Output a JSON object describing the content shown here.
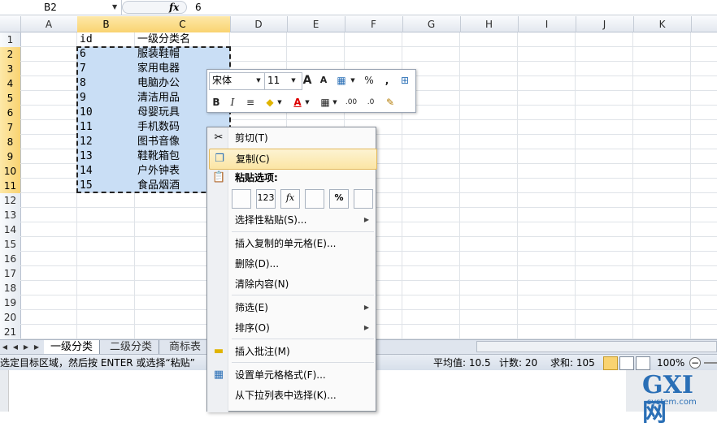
{
  "formula_bar": {
    "name_box": "B2",
    "fx_label": "fx",
    "value": "6"
  },
  "columns": [
    "A",
    "B",
    "C",
    "D",
    "E",
    "F",
    "G",
    "H",
    "I",
    "J",
    "K"
  ],
  "rows": [
    "1",
    "2",
    "3",
    "4",
    "5",
    "6",
    "7",
    "8",
    "9",
    "10",
    "11",
    "12",
    "13",
    "14",
    "15",
    "16",
    "17",
    "18",
    "19",
    "20",
    "21"
  ],
  "table": {
    "header": {
      "id": "id",
      "name": "一级分类名"
    },
    "rows": [
      {
        "id": "6",
        "name": "服装鞋帽"
      },
      {
        "id": "7",
        "name": "家用电器"
      },
      {
        "id": "8",
        "name": "电脑办公"
      },
      {
        "id": "9",
        "name": "清洁用品"
      },
      {
        "id": "10",
        "name": "母婴玩具"
      },
      {
        "id": "11",
        "name": "手机数码"
      },
      {
        "id": "12",
        "name": "图书音像"
      },
      {
        "id": "13",
        "name": "鞋靴箱包"
      },
      {
        "id": "14",
        "name": "户外钟表"
      },
      {
        "id": "15",
        "name": "食品烟酒"
      }
    ]
  },
  "mini_toolbar": {
    "font": "宋体",
    "size": "11",
    "percent": "%",
    "comma": ","
  },
  "context_menu": {
    "cut": "剪切(T)",
    "copy": "复制(C)",
    "paste_options_title": "粘贴选项:",
    "paste_option_labels": [
      "",
      "123",
      "fx",
      "",
      "%",
      ""
    ],
    "paste_special": "选择性粘贴(S)...",
    "insert_copied": "插入复制的单元格(E)...",
    "delete": "删除(D)...",
    "clear": "清除内容(N)",
    "filter": "筛选(E)",
    "sort": "排序(O)",
    "insert_comment": "插入批注(M)",
    "format_cells": "设置单元格格式(F)...",
    "pick_from_list": "从下拉列表中选择(K)..."
  },
  "sheet_tabs": [
    "一级分类",
    "二级分类",
    "商标表"
  ],
  "status_bar": {
    "message": "选定目标区域，然后按 ENTER 或选择“粘贴”",
    "average": "平均值: 10.5",
    "count": "计数: 20",
    "sum": "求和: 105",
    "zoom": "100%"
  },
  "watermark": {
    "main": "GXI网",
    "sub": "system.com"
  },
  "colors": {
    "selection": "#c9def5",
    "header_selected": "#f9d371",
    "highlight": "#fbe5a4"
  }
}
